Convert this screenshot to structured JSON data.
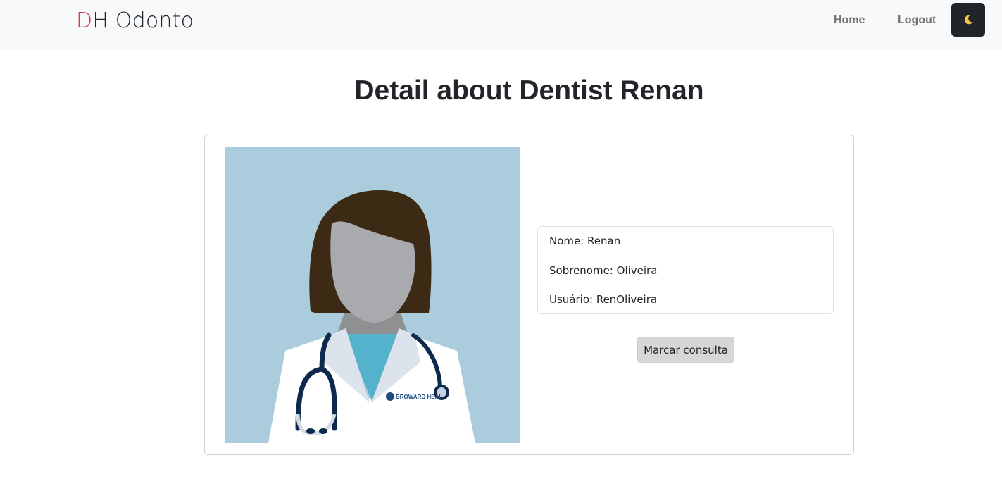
{
  "navbar": {
    "brand_initial": "D",
    "brand_rest": "H Odonto",
    "links": {
      "home": "Home",
      "logout": "Logout"
    },
    "theme_toggle_icon": "moon-icon",
    "colors": {
      "brand_accent": "#dc3545",
      "toggle_bg": "#212529",
      "moon": "#f5c542"
    }
  },
  "page": {
    "title": "Detail about Dentist Renan"
  },
  "dentist": {
    "avatar_badge_text": "BROWARD HEAL",
    "fields": [
      {
        "text": "Nome: Renan"
      },
      {
        "text": "Sobrenome: Oliveira"
      },
      {
        "text": "Usuário: RenOliveira"
      }
    ],
    "action_label": "Marcar consulta"
  }
}
